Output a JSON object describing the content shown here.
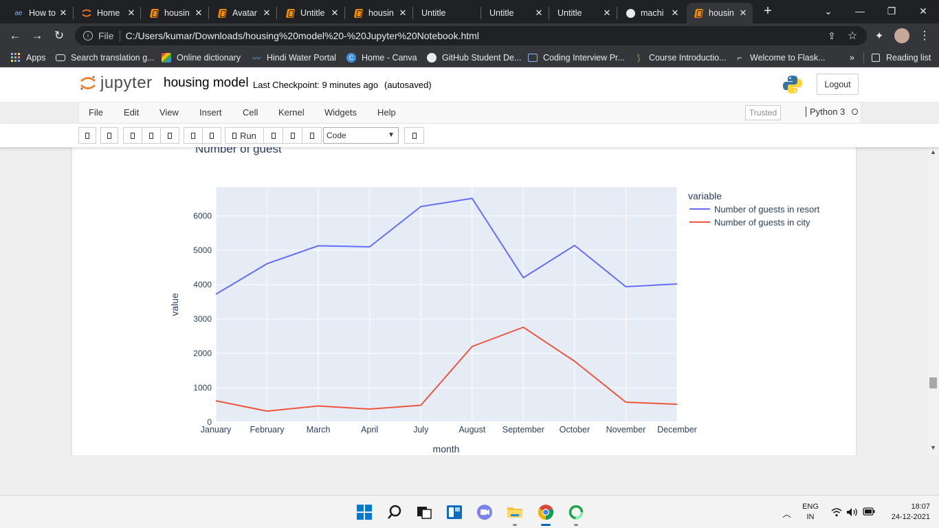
{
  "browser": {
    "tabs": [
      {
        "title": "How to",
        "icon": "ae-icon"
      },
      {
        "title": "Home",
        "icon": "jupyter-icon"
      },
      {
        "title": "housin",
        "icon": "notebook-icon"
      },
      {
        "title": "Avatar",
        "icon": "notebook-icon"
      },
      {
        "title": "Untitle",
        "icon": "notebook-icon"
      },
      {
        "title": "housin",
        "icon": "notebook-icon"
      },
      {
        "title": "Untitle",
        "icon": ""
      },
      {
        "title": "Untitle",
        "icon": ""
      },
      {
        "title": "Untitle",
        "icon": ""
      },
      {
        "title": "machi",
        "icon": "github-icon"
      },
      {
        "title": "housin",
        "icon": "notebook-icon"
      }
    ],
    "address": {
      "scheme_label": "File",
      "url": "C:/Users/kumar/Downloads/housing%20model%20-%20Jupyter%20Notebook.html"
    },
    "bookmarks": [
      {
        "label": "Apps"
      },
      {
        "label": "Search translation g..."
      },
      {
        "label": "Online dictionary"
      },
      {
        "label": "Hindi Water Portal"
      },
      {
        "label": "Home - Canva"
      },
      {
        "label": "GitHub Student De..."
      },
      {
        "label": "Coding Interview Pr..."
      },
      {
        "label": "Course Introductio..."
      },
      {
        "label": "Welcome to Flask..."
      }
    ],
    "bookmarks_more": "»",
    "reading_list": "Reading list"
  },
  "jupyter": {
    "logo_text": "jupyter",
    "notebook_name": "housing model",
    "checkpoint": "Last Checkpoint: 9 minutes ago",
    "autosave": "(autosaved)",
    "logout": "Logout",
    "menus": [
      "File",
      "Edit",
      "View",
      "Insert",
      "Cell",
      "Kernel",
      "Widgets",
      "Help"
    ],
    "trusted": "Trusted",
    "kernel": "Python 3",
    "run_label": "Run",
    "cell_type": "Code"
  },
  "chart_data": {
    "type": "line",
    "title": "Number of guest",
    "xlabel": "month",
    "ylabel": "value",
    "legend_title": "variable",
    "legend_position": "right",
    "categories": [
      "January",
      "February",
      "March",
      "April",
      "July",
      "August",
      "September",
      "October",
      "November",
      "December"
    ],
    "series": [
      {
        "name": "Number of guests in resort",
        "color": "#636efa",
        "values": [
          3720,
          4610,
          5130,
          5100,
          6270,
          6510,
          4200,
          5140,
          3940,
          4020
        ]
      },
      {
        "name": "Number of guests in city",
        "color": "#ef553b",
        "values": [
          620,
          320,
          470,
          380,
          490,
          2200,
          2760,
          1770,
          580,
          520
        ]
      }
    ],
    "ylim": [
      0,
      6840
    ],
    "yticks": [
      "0",
      "1000",
      "2000",
      "3000",
      "4000",
      "5000",
      "6000"
    ],
    "grid": true
  },
  "taskbar": {
    "lang_top": "ENG",
    "lang_bottom": "IN",
    "time": "18:07",
    "date": "24-12-2021"
  }
}
